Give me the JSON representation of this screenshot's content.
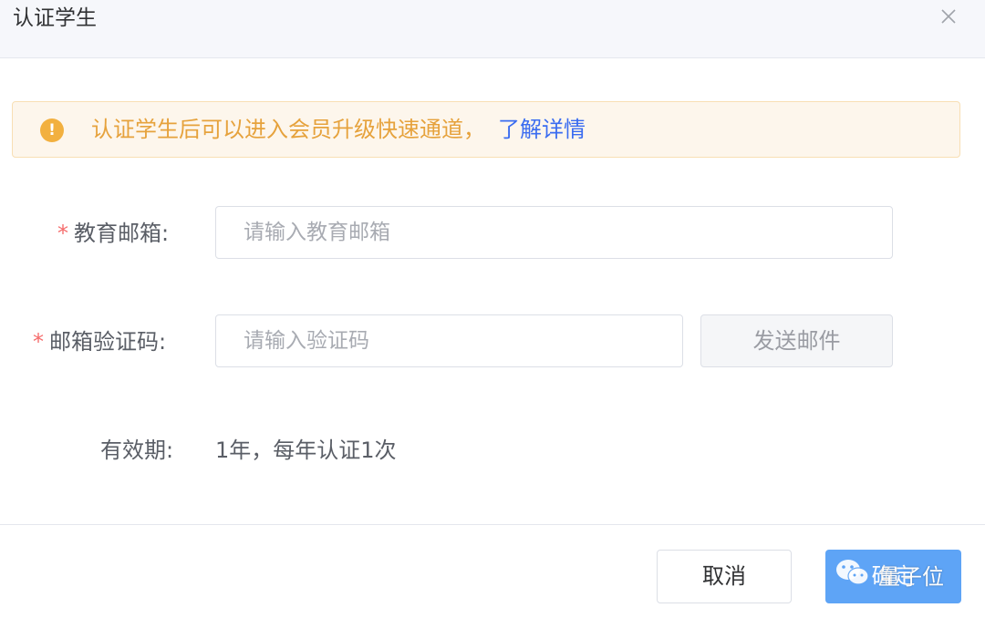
{
  "dialog": {
    "title": "认证学生",
    "close_icon": "close-icon"
  },
  "alert": {
    "icon": "warning-icon",
    "icon_glyph": "!",
    "message": "认证学生后可以进入会员升级快速通道，",
    "link": "了解详情",
    "color": "#e6a23c"
  },
  "form": {
    "email": {
      "required_mark": "*",
      "label": "教育邮箱:",
      "value": "",
      "placeholder": "请输入教育邮箱"
    },
    "code": {
      "required_mark": "*",
      "label": "邮箱验证码:",
      "value": "",
      "placeholder": "请输入验证码",
      "send_button": "发送邮件"
    },
    "validity": {
      "label": "有效期:",
      "value": "1年，每年认证1次"
    }
  },
  "footer": {
    "cancel": "取消",
    "confirm": "确定",
    "primary_color": "#5ea4f6"
  },
  "watermark": {
    "icon": "wechat-icon",
    "text": "量子位"
  }
}
